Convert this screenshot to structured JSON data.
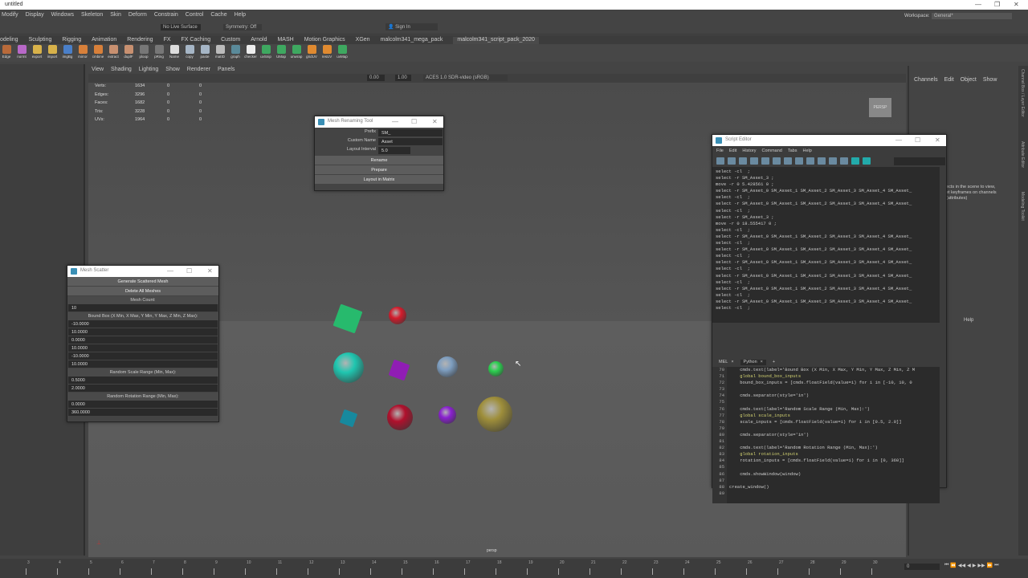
{
  "window": {
    "title": "untitled",
    "minimize": "—",
    "restore": "❐",
    "close": "✕"
  },
  "menubar": [
    "Modify",
    "Display",
    "Windows",
    "Skeleton",
    "Skin",
    "Deform",
    "Constrain",
    "Control",
    "Cache",
    "Help"
  ],
  "statusline": {
    "live_surface": "No Live Surface",
    "symmetry": "Symmetry: Off",
    "sign_in": "Sign In",
    "workspace_label": "Workspace:",
    "workspace_value": "General*"
  },
  "shelf_tabs": [
    "odeling",
    "Sculpting",
    "Rigging",
    "Animation",
    "Rendering",
    "FX",
    "FX Caching",
    "Custom",
    "Arnold",
    "MASH",
    "Motion Graphics",
    "XGen",
    "malcolm341_mega_pack",
    "malcolm341_script_pack_2020"
  ],
  "shelf_active_tab": "malcolm341_script_pack_2020",
  "shelf_icons": [
    {
      "label": "Edge",
      "color": "#b96a3a"
    },
    {
      "label": "normt",
      "color": "#b868c8"
    },
    {
      "label": "export",
      "color": "#d8b24a"
    },
    {
      "label": "import",
      "color": "#d8b24a"
    },
    {
      "label": "imgBg",
      "color": "#4a7fc8"
    },
    {
      "label": "mirror",
      "color": "#d8803a"
    },
    {
      "label": "cmbine",
      "color": "#d8803a"
    },
    {
      "label": "extract",
      "color": "#c89070"
    },
    {
      "label": "duplF",
      "color": "#c89070"
    },
    {
      "label": "ploop",
      "color": "#777"
    },
    {
      "label": "pRing",
      "color": "#777"
    },
    {
      "label": "Name",
      "color": "#ddd"
    },
    {
      "label": "copy",
      "color": "#a6b6c6"
    },
    {
      "label": "paste",
      "color": "#a6b6c6"
    },
    {
      "label": "matID",
      "color": "#bbb"
    },
    {
      "label": "graph",
      "color": "#5a8a9a"
    },
    {
      "label": "checker",
      "color": "#eee"
    },
    {
      "label": "uvSnip",
      "color": "#3ea860"
    },
    {
      "label": "UMap",
      "color": "#3ea860"
    },
    {
      "label": "unwrap",
      "color": "#3ea860"
    },
    {
      "label": "gridUV",
      "color": "#e08a30"
    },
    {
      "label": "resUV",
      "color": "#e08a30"
    },
    {
      "label": "uvMap",
      "color": "#3ea860"
    }
  ],
  "viewport": {
    "menu": [
      "View",
      "Shading",
      "Lighting",
      "Show",
      "Renderer",
      "Panels"
    ],
    "exposure": "0.00",
    "gamma": "1.00",
    "colorspace": "ACES 1.0 SDR-video (sRGB)",
    "hud": [
      {
        "label": "Verts:",
        "v": [
          "1634",
          "0",
          "0"
        ]
      },
      {
        "label": "Edges:",
        "v": [
          "3296",
          "0",
          "0"
        ]
      },
      {
        "label": "Faces:",
        "v": [
          "1682",
          "0",
          "0"
        ]
      },
      {
        "label": "Tris:",
        "v": [
          "3228",
          "0",
          "0"
        ]
      },
      {
        "label": "UVs:",
        "v": [
          "1964",
          "0",
          "0"
        ]
      }
    ],
    "camera": "persp",
    "viewcube": "PERSP",
    "objects": [
      {
        "name": "cube-green",
        "shape": "cube",
        "color": "#2bcf79"
      },
      {
        "name": "sphere-red",
        "shape": "sphere",
        "color": "#d41c2c"
      },
      {
        "name": "sphere-teal",
        "shape": "sphere",
        "color": "#1fc6b0"
      },
      {
        "name": "cube-purple",
        "shape": "cube",
        "color": "#a020c8"
      },
      {
        "name": "sphere-blue-grey",
        "shape": "sphere",
        "color": "#7e9ec0"
      },
      {
        "name": "sphere-green",
        "shape": "sphere",
        "color": "#2bcf4f"
      },
      {
        "name": "cube-teal",
        "shape": "cube",
        "color": "#1a98b0"
      },
      {
        "name": "sphere-crimson",
        "shape": "sphere",
        "color": "#b0102c"
      },
      {
        "name": "sphere-violet",
        "shape": "sphere",
        "color": "#8a20d0"
      },
      {
        "name": "sphere-olive",
        "shape": "sphere",
        "color": "#9e8e3a"
      }
    ]
  },
  "channel_box": {
    "menu": [
      "Channels",
      "Edit",
      "Object",
      "Show"
    ],
    "hint": [
      "ects in the scene to view,",
      "et keyframes on channels",
      "(attributes)"
    ],
    "layer_menu": "Help"
  },
  "side_tabs": [
    "Channel Box / Layer Editor",
    "Attribute Editor",
    "Modeling Toolkit"
  ],
  "mesh_renaming_tool": {
    "title": "Mesh Renaming Tool",
    "prefix_label": "Prefix",
    "prefix_value": "SM_",
    "custom_name_label": "Custom Name",
    "custom_name_value": "Asset",
    "layout_interval_label": "Layout Interval",
    "layout_interval_value": "5.0",
    "rename": "Rename",
    "prepare": "Prepare",
    "layout": "Layout in Matrix"
  },
  "mesh_scatter": {
    "title": "Mesh Scatter",
    "generate": "Generate Scattered Mesh",
    "delete": "Delete All Meshes",
    "mesh_count_label": "Mesh Count:",
    "mesh_count": "10",
    "bound_box_label": "Bound Box (X Min, X Max, Y Min, Y Max, Z Min, Z Max):",
    "bound_box": [
      "-10.0000",
      "10.0000",
      "0.0000",
      "10.0000",
      "-10.0000",
      "10.0000"
    ],
    "scale_label": "Random Scale Range (Min, Max):",
    "scale": [
      "0.5000",
      "2.0000"
    ],
    "rotation_label": "Random Rotation Range (Min, Max):",
    "rotation": [
      "0.0000",
      "360.0000"
    ]
  },
  "script_editor": {
    "title": "Script Editor",
    "menu": [
      "File",
      "Edit",
      "History",
      "Command",
      "Tabs",
      "Help"
    ],
    "history": [
      "select -cl  ;",
      "select -r SM_Asset_3 ;",
      "move -r 0 5.428561 0 ;",
      "select -r SM_Asset_0 SM_Asset_1 SM_Asset_2 SM_Asset_3 SM_Asset_4 SM_Asset_",
      "select -cl  ;",
      "select -r SM_Asset_0 SM_Asset_1 SM_Asset_2 SM_Asset_3 SM_Asset_4 SM_Asset_",
      "select -cl  ;",
      "select -r SM_Asset_3 ;",
      "move -r 0 18.555417 0 ;",
      "select -cl  ;",
      "select -r SM_Asset_0 SM_Asset_1 SM_Asset_2 SM_Asset_3 SM_Asset_4 SM_Asset_",
      "select -cl  ;",
      "select -r SM_Asset_0 SM_Asset_1 SM_Asset_2 SM_Asset_3 SM_Asset_4 SM_Asset_",
      "select -cl  ;",
      "select -r SM_Asset_0 SM_Asset_1 SM_Asset_2 SM_Asset_3 SM_Asset_4 SM_Asset_",
      "select -cl  ;",
      "select -r SM_Asset_0 SM_Asset_1 SM_Asset_2 SM_Asset_3 SM_Asset_4 SM_Asset_",
      "select -cl  ;",
      "select -r SM_Asset_0 SM_Asset_1 SM_Asset_2 SM_Asset_3 SM_Asset_4 SM_Asset_",
      "select -cl  ;",
      "select -r SM_Asset_0 SM_Asset_1 SM_Asset_2 SM_Asset_3 SM_Asset_4 SM_Asset_",
      "select -cl  ;"
    ],
    "tabs": [
      "MEL",
      "Python"
    ],
    "tab_close": "×",
    "tab_add": "+",
    "line_numbers": [
      "70",
      "71",
      "72",
      "73",
      "74",
      "75",
      "76",
      "77",
      "78",
      "79",
      "80",
      "81",
      "82",
      "83",
      "84",
      "85",
      "86",
      "87",
      "88",
      "89"
    ],
    "code": [
      "    cmds.text(label='Bound Box (X Min, X Max, Y Min, Y Max, Z Min, Z M",
      "    global bound_box_inputs",
      "    bound_box_inputs = [cmds.floatField(value=i) for i in [-10, 10, 0",
      "",
      "    cmds.separator(style='in')",
      "",
      "    cmds.text(label='Random Scale Range (Min, Max):')",
      "    global scale_inputs",
      "    scale_inputs = [cmds.floatField(value=i) for i in [0.5, 2.0]]",
      "",
      "    cmds.separator(style='in')",
      "",
      "    cmds.text(label='Random Rotation Range (Min, Max):')",
      "    global rotation_inputs",
      "    rotation_inputs = [cmds.floatField(value=i) for i in [0, 360]]",
      "",
      "    cmds.showWindow(window)",
      "",
      "create_window()",
      ""
    ]
  },
  "timeline": {
    "ticks": [
      "3",
      "4",
      "5",
      "6",
      "7",
      "8",
      "9",
      "10",
      "11",
      "12",
      "13",
      "14",
      "15",
      "16",
      "17",
      "18",
      "19",
      "20",
      "21",
      "22",
      "23",
      "24",
      "25",
      "26",
      "27",
      "28",
      "29",
      "30"
    ],
    "current_frame": "0",
    "playback": [
      "⏮",
      "⏪",
      "◀◀",
      "◀",
      "▶",
      "▶▶",
      "⏩",
      "⏭"
    ]
  }
}
